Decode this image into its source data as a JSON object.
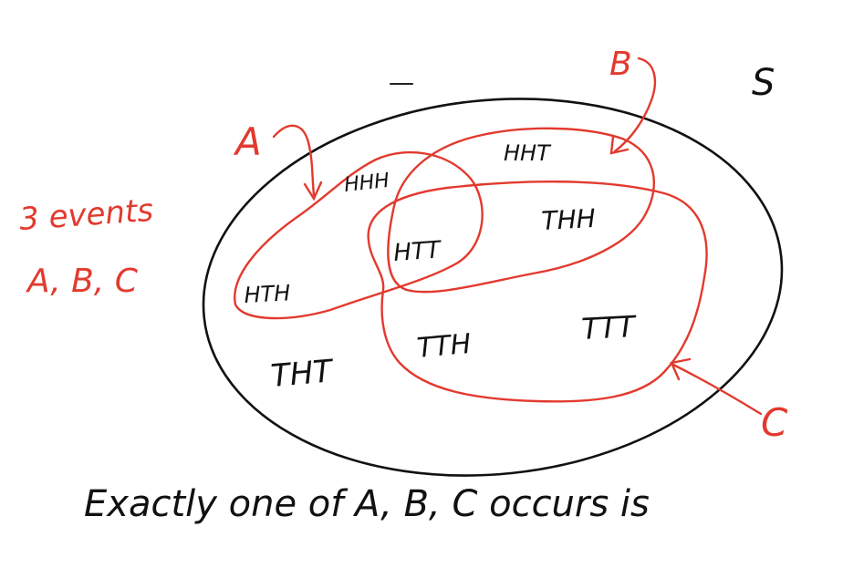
{
  "sample_space_label": "S",
  "side_note": {
    "line1": "3 events",
    "line2": "A, B, C"
  },
  "event_labels": {
    "a": "A",
    "b": "B",
    "c": "C"
  },
  "outcomes": {
    "hhh": "HHH",
    "hht": "HHT",
    "htt": "HTT",
    "thh": "THH",
    "hth": "HTH",
    "tht": "THT",
    "tth": "TTH",
    "ttt": "TTT"
  },
  "caption": "Exactly one of A, B, C occurs is",
  "colors": {
    "ink": "#111111",
    "event": "#e23a2e"
  }
}
